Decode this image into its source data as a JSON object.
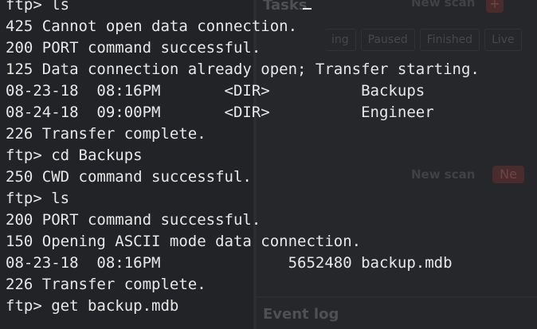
{
  "background_app": {
    "title": "Tasks",
    "new_scan_label": "New scan",
    "new_scan_label_2": "New scan",
    "plus_label": "+",
    "plus_label_2": "Ne",
    "tabs": [
      "ing",
      "Paused",
      "Finished",
      "Live"
    ],
    "event_log_title": "Event log"
  },
  "terminal": {
    "lines": [
      "ftp> ls",
      "425 Cannot open data connection.",
      "200 PORT command successful.",
      "125 Data connection already open; Transfer starting.",
      "08-23-18  08:16PM       <DIR>          Backups",
      "08-24-18  09:00PM       <DIR>          Engineer",
      "226 Transfer complete.",
      "ftp> cd Backups",
      "250 CWD command successful.",
      "ftp> ls",
      "200 PORT command successful.",
      "150 Opening ASCII mode data connection.",
      "08-23-18  08:16PM              5652480 backup.mdb",
      "226 Transfer complete.",
      "ftp> get backup.mdb"
    ]
  }
}
